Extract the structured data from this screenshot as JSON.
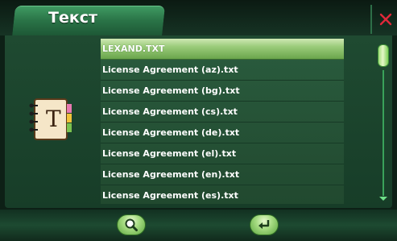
{
  "header": {
    "title": "Текст",
    "close_icon": "close-icon"
  },
  "document_icon": "text-document-icon",
  "file_list": [
    {
      "name": "LEXAND.TXT",
      "selected": true
    },
    {
      "name": "License Agreement (az).txt",
      "selected": false
    },
    {
      "name": "License Agreement (bg).txt",
      "selected": false
    },
    {
      "name": "License Agreement (cs).txt",
      "selected": false
    },
    {
      "name": "License Agreement (de).txt",
      "selected": false
    },
    {
      "name": "License Agreement (el).txt",
      "selected": false
    },
    {
      "name": "License Agreement (en).txt",
      "selected": false
    },
    {
      "name": "License Agreement (es).txt",
      "selected": false
    }
  ],
  "scrollbar": {
    "position": 0.0
  },
  "toolbar": {
    "search_icon": "search-icon",
    "back_icon": "return-arrow-icon"
  },
  "colors": {
    "accent": "#3aa25a",
    "selection": "#9acb79",
    "close": "#e0283a"
  }
}
